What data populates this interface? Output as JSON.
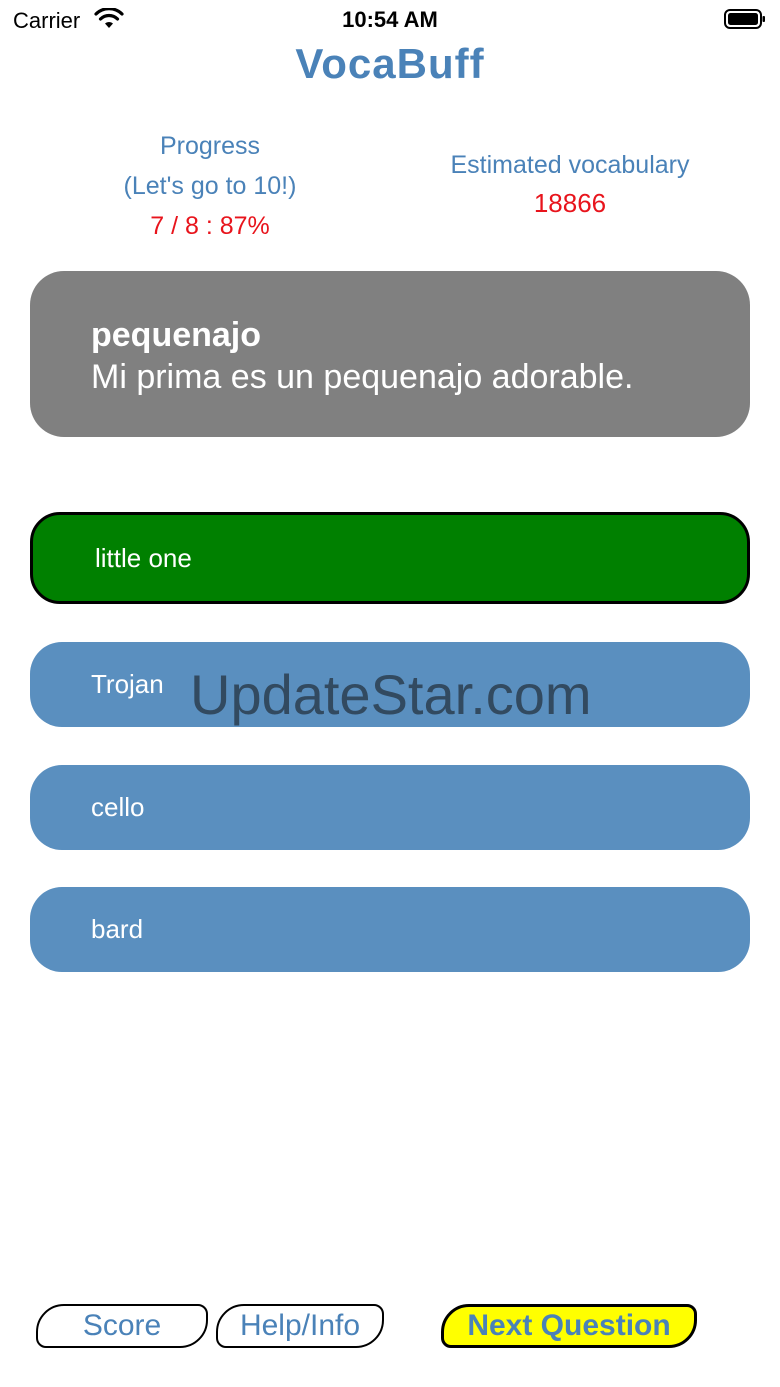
{
  "status_bar": {
    "carrier": "Carrier",
    "time": "10:54 AM",
    "wifi_icon": "wifi-icon",
    "battery_icon": "battery-icon"
  },
  "app": {
    "title": "VocaBuff",
    "accent_color": "#4a82b8",
    "highlight_color": "#e8141c"
  },
  "progress": {
    "title_line1": "Progress",
    "title_line2": "(Let's go to 10!)",
    "value": "7 / 8 : 87%"
  },
  "vocabulary": {
    "title": "Estimated vocabulary",
    "value": "18866"
  },
  "question": {
    "word": "pequenajo",
    "sentence": "Mi prima es un pequenajo adorable."
  },
  "answers": [
    {
      "label": "little one",
      "state": "correct"
    },
    {
      "label": "Trojan",
      "state": "default"
    },
    {
      "label": "cello",
      "state": "default"
    },
    {
      "label": "bard",
      "state": "default"
    }
  ],
  "watermark": "UpdateStar.com",
  "buttons": {
    "score": "Score",
    "help": "Help/Info",
    "next": "Next Question"
  }
}
